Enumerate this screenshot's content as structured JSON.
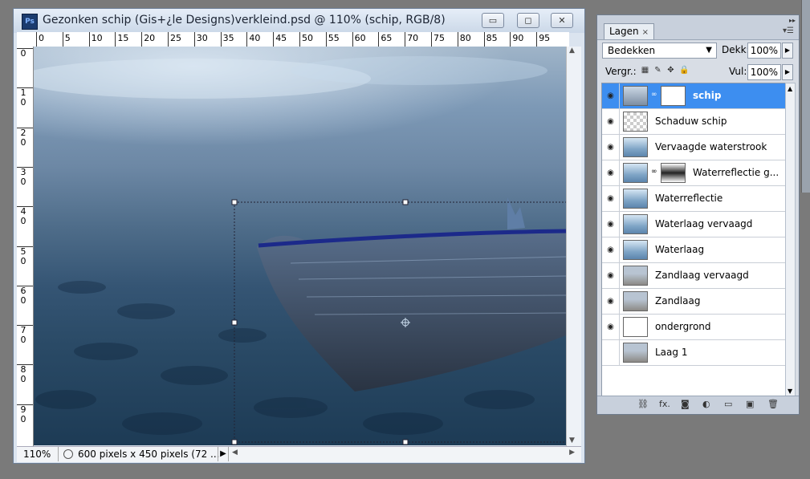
{
  "document": {
    "title": "Gezonken schip (Gis+¿le Designs)verkleind.psd @ 110% (schip, RGB/8)",
    "app_icon_text": "Ps",
    "ruler_top": [
      "0",
      "5",
      "10",
      "15",
      "20",
      "25",
      "30",
      "35",
      "40",
      "45",
      "50",
      "55",
      "60",
      "65",
      "70",
      "75",
      "80",
      "85",
      "90",
      "95"
    ],
    "ruler_left": [
      [
        "0",
        ""
      ],
      [
        "1",
        "0"
      ],
      [
        "2",
        "0"
      ],
      [
        "3",
        "0"
      ],
      [
        "4",
        "0"
      ],
      [
        "5",
        "0"
      ],
      [
        "6",
        "0"
      ],
      [
        "7",
        "0"
      ],
      [
        "8",
        "0"
      ],
      [
        "9",
        "0"
      ]
    ],
    "status": {
      "zoom": "110%",
      "info": "600 pixels x 450 pixels (72 ..."
    },
    "window_buttons": {
      "minimize": "▭",
      "maximize": "◻",
      "close": "✕"
    }
  },
  "layers_panel": {
    "tab": "Lagen",
    "tab_close": "×",
    "blend_mode": "Bedekken",
    "opacity_label": "Dekk:",
    "opacity": "100%",
    "lock_label": "Vergr.:",
    "fill_label": "Vul:",
    "fill": "100%",
    "layers": [
      {
        "name": "schip",
        "visible": true,
        "selected": true,
        "thumb": "ship",
        "mask": true
      },
      {
        "name": "Schaduw schip",
        "visible": true,
        "selected": false,
        "thumb": "checker",
        "mask": false
      },
      {
        "name": "Vervaagde waterstrook",
        "visible": true,
        "selected": false,
        "thumb": "water",
        "mask": false
      },
      {
        "name": "Waterreflectie g...",
        "visible": true,
        "selected": false,
        "thumb": "water",
        "mask": true
      },
      {
        "name": "Waterreflectie",
        "visible": true,
        "selected": false,
        "thumb": "water",
        "mask": false
      },
      {
        "name": "Waterlaag vervaagd",
        "visible": true,
        "selected": false,
        "thumb": "water",
        "mask": false
      },
      {
        "name": "Waterlaag",
        "visible": true,
        "selected": false,
        "thumb": "water",
        "mask": false
      },
      {
        "name": "Zandlaag vervaagd",
        "visible": true,
        "selected": false,
        "thumb": "sand",
        "mask": false
      },
      {
        "name": "Zandlaag",
        "visible": true,
        "selected": false,
        "thumb": "sand",
        "mask": false
      },
      {
        "name": "ondergrond",
        "visible": true,
        "selected": false,
        "thumb": "white",
        "mask": false
      },
      {
        "name": "Laag 1",
        "visible": false,
        "selected": false,
        "thumb": "sand",
        "mask": false
      }
    ],
    "footer_icons": [
      "link-icon",
      "fx-icon",
      "mask-icon",
      "adjustment-icon",
      "group-icon",
      "new-layer-icon",
      "trash-icon"
    ],
    "footer_glyphs": [
      "⛓",
      "fx.",
      "◙",
      "◐",
      "▭",
      "▣",
      "🗑"
    ]
  },
  "colors": {
    "selection_blue": "#3d8ef0",
    "titlebar": "#cbd8e8"
  }
}
